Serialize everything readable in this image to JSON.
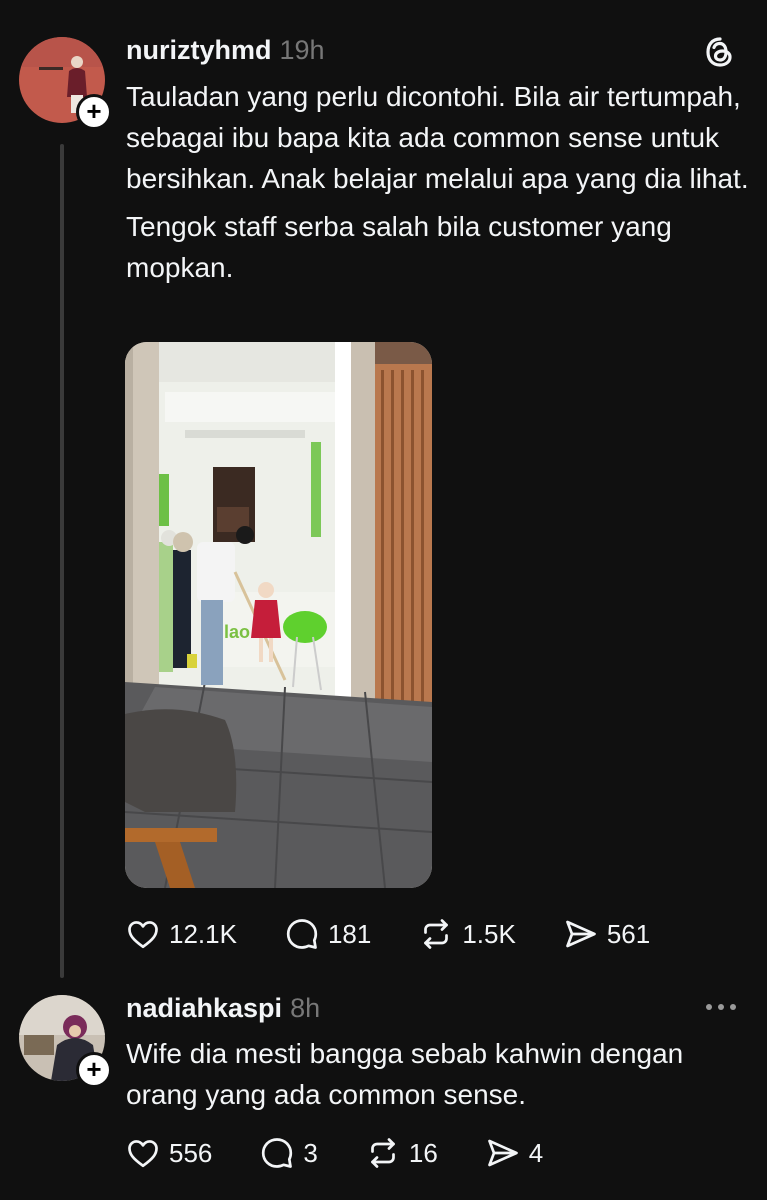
{
  "post": {
    "username": "nuriztyhmd",
    "time": "19h",
    "paragraph1": "Tauladan yang perlu dicontohi. Bila air tertumpah, sebagai ibu bapa kita ada common sense untuk bersihkan. Anak belajar melalui apa yang dia lihat.",
    "paragraph2": "Tengok staff serba salah bila customer yang mopkan.",
    "photo_sign_text": "llao",
    "likes": "12.1K",
    "replies": "181",
    "reposts": "1.5K",
    "shares": "561"
  },
  "reply": {
    "username": "nadiahkaspi",
    "time": "8h",
    "text": "Wife dia mesti bangga sebab kahwin dengan orang yang ada common sense.",
    "likes": "556",
    "replies": "3",
    "reposts": "16",
    "shares": "4"
  },
  "icons": {
    "threads_logo": "threads-logo-icon",
    "follow": "plus-icon",
    "like": "heart-icon",
    "reply": "comment-icon",
    "repost": "repost-icon",
    "share": "send-icon",
    "more": "more-dots-icon"
  }
}
